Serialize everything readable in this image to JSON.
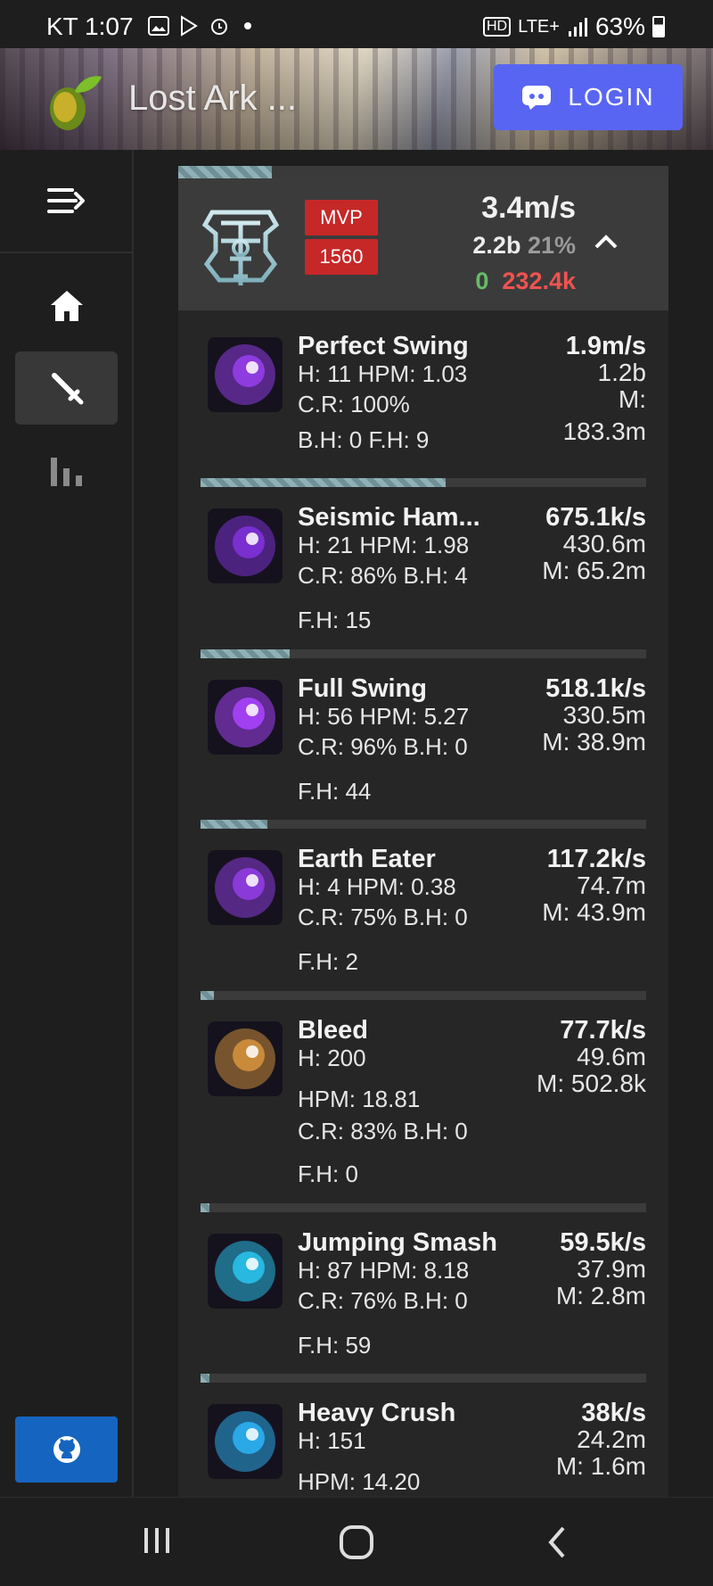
{
  "status_bar": {
    "time": "KT 1:07",
    "network": "LTE+",
    "hd": "HD",
    "battery": "63%"
  },
  "header": {
    "app_title": "Lost Ark ...",
    "login_label": "LOGIN"
  },
  "sidebar": {
    "items": [
      "menu-toggle",
      "home",
      "sword",
      "stats"
    ],
    "active": "sword",
    "github": "github"
  },
  "summary": {
    "progress_fraction": 0.19,
    "badges": [
      "MVP",
      "1560"
    ],
    "dps": "3.4m/s",
    "total": "2.2b",
    "percent": "21%",
    "green_value": "0",
    "red_value": "232.4k"
  },
  "skills": [
    {
      "name": "Perfect Swing",
      "bar_fraction": 0,
      "line1": "H: 11  HPM: 1.03",
      "line2": "C.R: 100%",
      "line3": "B.H: 0   F.H: 9",
      "line4": "",
      "dps": "1.9m/s",
      "total": "1.2b",
      "max_label": "M:",
      "max_value": "183.3m",
      "color": "#8e3be0"
    },
    {
      "name": "Seismic Ham...",
      "bar_fraction": 0.55,
      "line1": "H: 21  HPM: 1.98",
      "line2": "C.R: 86%  B.H: 4",
      "line3": "F.H: 15",
      "line4": "",
      "dps": "675.1k/s",
      "total": "430.6m",
      "max_label": "M: 65.2m",
      "max_value": "",
      "color": "#7a2fd0"
    },
    {
      "name": "Full Swing",
      "bar_fraction": 0.2,
      "line1": "H: 56  HPM: 5.27",
      "line2": "C.R: 96%  B.H: 0",
      "line3": "F.H: 44",
      "line4": "",
      "dps": "518.1k/s",
      "total": "330.5m",
      "max_label": "M: 38.9m",
      "max_value": "",
      "color": "#a040f0"
    },
    {
      "name": "Earth Eater",
      "bar_fraction": 0.15,
      "line1": "H: 4  HPM: 0.38",
      "line2": "C.R: 75%  B.H: 0",
      "line3": "F.H: 2",
      "line4": "",
      "dps": "117.2k/s",
      "total": "74.7m",
      "max_label": "M: 43.9m",
      "max_value": "",
      "color": "#8a3ad8"
    },
    {
      "name": "Bleed",
      "bar_fraction": 0.03,
      "line1": "H: 200",
      "line2": "HPM: 18.81",
      "line3": "C.R: 83%  B.H: 0",
      "line4": "F.H: 0",
      "dps": "77.7k/s",
      "total": "49.6m",
      "max_label": "M: 502.8k",
      "max_value": "",
      "color": "#c98a3a"
    },
    {
      "name": "Jumping Smash",
      "bar_fraction": 0.02,
      "line1": "H: 87  HPM: 8.18",
      "line2": "C.R: 76%  B.H: 0",
      "line3": "F.H: 59",
      "line4": "",
      "dps": "59.5k/s",
      "total": "37.9m",
      "max_label": "M: 2.8m",
      "max_value": "",
      "color": "#28b8e0"
    },
    {
      "name": "Heavy Crush",
      "bar_fraction": 0.02,
      "line1": "H: 151",
      "line2": "HPM: 14.20",
      "line3": "",
      "line4": "",
      "dps": "38k/s",
      "total": "24.2m",
      "max_label": "M: 1.6m",
      "max_value": "",
      "color": "#2aa8e8"
    }
  ],
  "navbar": {
    "buttons": [
      "recent-apps",
      "home",
      "back"
    ]
  }
}
